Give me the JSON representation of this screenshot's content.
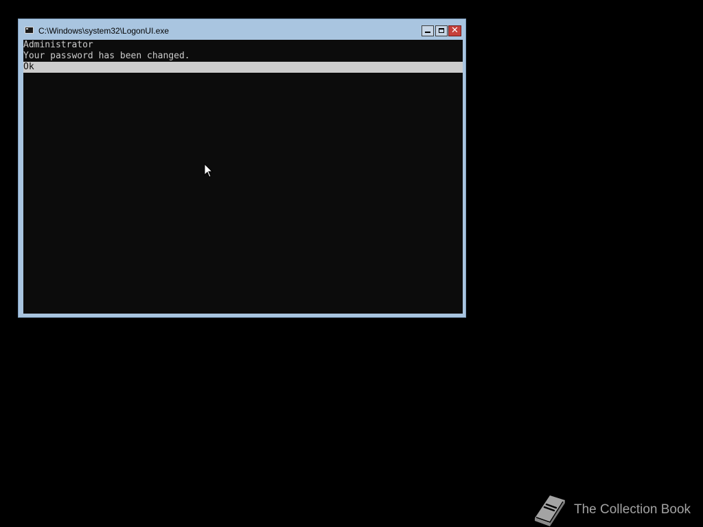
{
  "window": {
    "title": "C:\\Windows\\system32\\LogonUI.exe",
    "icon": "console-app-icon",
    "controls": {
      "minimize": "minimize-icon",
      "maximize": "maximize-icon",
      "close": "close-icon"
    }
  },
  "console": {
    "lines": [
      "Administrator",
      "Your password has been changed."
    ],
    "selected_option": "Ok"
  },
  "watermark": {
    "text": "The Collection Book",
    "icon": "book-icon"
  },
  "colors": {
    "desktop_background": "#000000",
    "window_frame": "#a9c5e0",
    "console_background": "#0c0c0c",
    "console_text": "#cccccc",
    "selection_highlight": "#cccccc",
    "close_button": "#c6403b",
    "watermark": "#a3a3a3"
  }
}
